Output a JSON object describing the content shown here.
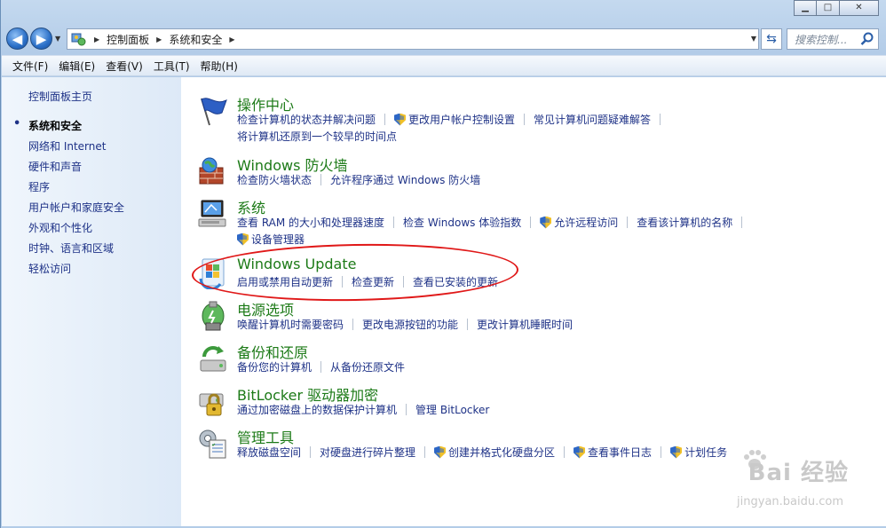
{
  "caption": {
    "minimize": "▁",
    "maximize": "□",
    "close": "✕"
  },
  "address": {
    "breadcrumbs": [
      "控制面板",
      "系统和安全"
    ],
    "search_placeholder": "搜索控制..."
  },
  "menubar": [
    "文件(F)",
    "编辑(E)",
    "查看(V)",
    "工具(T)",
    "帮助(H)"
  ],
  "sidebar": {
    "home": "控制面板主页",
    "items": [
      {
        "label": "系统和安全",
        "active": true
      },
      {
        "label": "网络和 Internet"
      },
      {
        "label": "硬件和声音"
      },
      {
        "label": "程序"
      },
      {
        "label": "用户帐户和家庭安全"
      },
      {
        "label": "外观和个性化"
      },
      {
        "label": "时钟、语言和区域"
      },
      {
        "label": "轻松访问"
      }
    ]
  },
  "categories": [
    {
      "title": "操作中心",
      "icon": "action-center-flag-icon",
      "links": [
        [
          {
            "text": "检查计算机的状态并解决问题"
          },
          {
            "text": "更改用户帐户控制设置",
            "shield": true
          },
          {
            "text": "常见计算机问题疑难解答"
          }
        ],
        [
          {
            "text": "将计算机还原到一个较早的时间点"
          }
        ]
      ]
    },
    {
      "title": "Windows 防火墙",
      "icon": "firewall-icon",
      "links": [
        [
          {
            "text": "检查防火墙状态"
          },
          {
            "text": "允许程序通过 Windows 防火墙"
          }
        ]
      ]
    },
    {
      "title": "系统",
      "icon": "system-computer-icon",
      "links": [
        [
          {
            "text": "查看 RAM 的大小和处理器速度"
          },
          {
            "text": "检查 Windows 体验指数"
          },
          {
            "text": "允许远程访问",
            "shield": true
          },
          {
            "text": "查看该计算机的名称"
          }
        ],
        [
          {
            "text": "设备管理器",
            "shield": true
          }
        ]
      ]
    },
    {
      "title": "Windows Update",
      "icon": "windows-update-icon",
      "links": [
        [
          {
            "text": "启用或禁用自动更新"
          },
          {
            "text": "检查更新"
          },
          {
            "text": "查看已安装的更新"
          }
        ]
      ]
    },
    {
      "title": "电源选项",
      "icon": "power-options-icon",
      "links": [
        [
          {
            "text": "唤醒计算机时需要密码"
          },
          {
            "text": "更改电源按钮的功能"
          },
          {
            "text": "更改计算机睡眠时间"
          }
        ]
      ]
    },
    {
      "title": "备份和还原",
      "icon": "backup-restore-icon",
      "links": [
        [
          {
            "text": "备份您的计算机"
          },
          {
            "text": "从备份还原文件"
          }
        ]
      ]
    },
    {
      "title": "BitLocker 驱动器加密",
      "icon": "bitlocker-icon",
      "links": [
        [
          {
            "text": "通过加密磁盘上的数据保护计算机"
          },
          {
            "text": "管理 BitLocker"
          }
        ]
      ]
    },
    {
      "title": "管理工具",
      "icon": "admin-tools-icon",
      "links": [
        [
          {
            "text": "释放磁盘空间"
          },
          {
            "text": "对硬盘进行碎片整理"
          },
          {
            "text": "创建并格式化硬盘分区",
            "shield": true
          },
          {
            "text": "查看事件日志",
            "shield": true
          },
          {
            "text": "计划任务",
            "shield": true
          }
        ]
      ]
    }
  ],
  "watermark": {
    "brand": "Bai 经验",
    "url": "jingyan.baidu.com"
  },
  "colors": {
    "link": "#1e3287",
    "category_title": "#1c7a17",
    "annotation": "#e01818"
  }
}
